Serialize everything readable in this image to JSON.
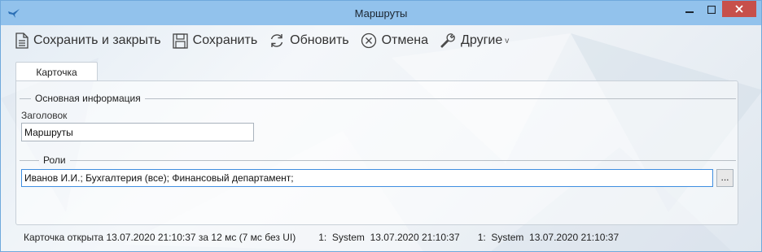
{
  "window": {
    "title": "Маршруты",
    "accent": "#92c2ec",
    "close_color": "#c7504b"
  },
  "toolbar": {
    "save_close": "Сохранить и закрыть",
    "save": "Сохранить",
    "refresh": "Обновить",
    "cancel": "Отмена",
    "other": "Другие"
  },
  "tabs": [
    {
      "label": "Карточка"
    }
  ],
  "form": {
    "basic_group": "Основная информация",
    "title_label": "Заголовок",
    "title_value": "Маршруты",
    "roles_group": "Роли",
    "roles_value": "Иванов И.И.; Бухгалтерия (все); Финансовый департамент;",
    "browse_label": "..."
  },
  "status": {
    "opened": "Карточка открыта 13.07.2020 21:10:37 за 12 мс (7 мс без UI)",
    "created": "1:  System  13.07.2020 21:10:37",
    "modified": "1:  System  13.07.2020 21:10:37"
  }
}
